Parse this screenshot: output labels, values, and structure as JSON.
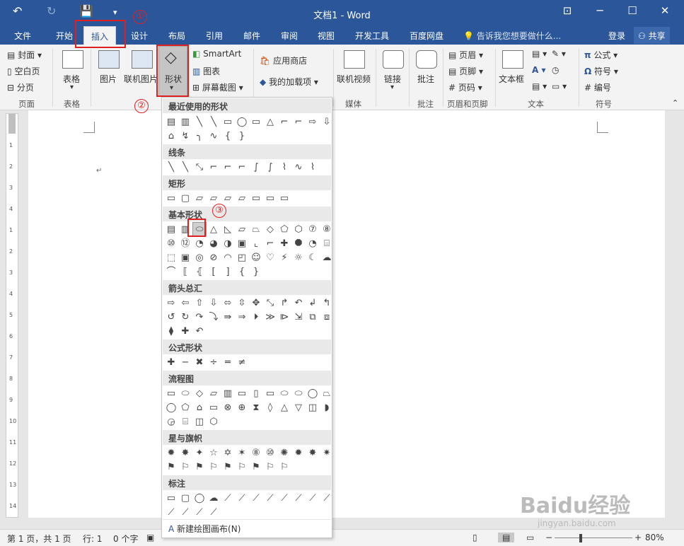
{
  "window": {
    "title": "文档1 - Word"
  },
  "titlebar_icons": [
    "undo-icon",
    "redo-icon",
    "save-icon",
    "customize-qat-icon"
  ],
  "tabs": [
    "文件",
    "开始",
    "插入",
    "设计",
    "布局",
    "引用",
    "邮件",
    "审阅",
    "视图",
    "开发工具",
    "百度网盘"
  ],
  "active_tab": "插入",
  "tell_me": "告诉我您想要做什么...",
  "login": "登录",
  "share": "共享",
  "ribbon": {
    "pages": {
      "cover": "封面",
      "blank": "空白页",
      "break": "分页",
      "group": "页面"
    },
    "tables": {
      "table": "表格",
      "group": "表格"
    },
    "illustrations": {
      "picture": "图片",
      "online_picture": "联机图片",
      "shapes": "形状",
      "smartart": "SmartArt",
      "chart": "图表",
      "screenshot": "屏幕截图"
    },
    "addins": {
      "store": "应用商店",
      "my_addins": "我的加载项"
    },
    "media": {
      "online_video": "联机视频",
      "group": "媒体"
    },
    "links": {
      "link": "链接"
    },
    "comments": {
      "comment": "批注",
      "group": "批注"
    },
    "header_footer": {
      "header": "页眉",
      "footer": "页脚",
      "page_number": "页码",
      "group": "页眉和页脚"
    },
    "text": {
      "textbox": "文本框",
      "group": "文本"
    },
    "symbols": {
      "equation": "公式",
      "symbol": "符号",
      "number": "编号",
      "group": "符号"
    }
  },
  "annotations": {
    "n1": "①",
    "n2": "②",
    "n3": "③"
  },
  "shapes_menu": {
    "sections": [
      "最近使用的形状",
      "线条",
      "矩形",
      "基本形状",
      "箭头总汇",
      "公式形状",
      "流程图",
      "星与旗帜",
      "标注"
    ],
    "new_canvas": "新建绘图画布(N)",
    "rows": {
      "recent1": [
        "▤",
        "▥",
        "╲",
        "╲",
        "▭",
        "◯",
        "▭",
        "△",
        "⌐",
        "⌐",
        "⇨",
        "⇩"
      ],
      "recent2": [
        "⌂",
        "↯",
        "╮",
        "∿",
        "{",
        "}"
      ],
      "lines": [
        "╲",
        "╲",
        "⤡",
        "⌐",
        "⌐",
        "⌐",
        "∫",
        "∫",
        "⌇",
        "∿",
        "⌇"
      ],
      "rects": [
        "▭",
        "▢",
        "▱",
        "▱",
        "▱",
        "▱",
        "▭",
        "▭",
        "▭"
      ],
      "basic1": [
        "▤",
        "▥",
        "⬭",
        "△",
        "◺",
        "▱",
        "⏢",
        "◇",
        "⬠",
        "⬡",
        "⑦",
        "⑧"
      ],
      "basic2": [
        "⑩",
        "⑫",
        "◔",
        "◕",
        "◑",
        "▣",
        "⌞",
        "⌐",
        "✚",
        "⯃",
        "◔",
        "⌸"
      ],
      "basic3": [
        "⬚",
        "▣",
        "◎",
        "⊘",
        "◠",
        "◰",
        "☺",
        "♡",
        "⚡",
        "☼",
        "☾",
        "☁"
      ],
      "basic4": [
        "⌒",
        "⟦",
        "⦃",
        "[",
        "]",
        "{",
        "}"
      ],
      "arrows1": [
        "⇨",
        "⇦",
        "⇧",
        "⇩",
        "⬄",
        "⇳",
        "✥",
        "⤡",
        "↱",
        "↶",
        "↲",
        "↰"
      ],
      "arrows2": [
        "↺",
        "↻",
        "↷",
        "⤵",
        "⇛",
        "⇒",
        "⏵",
        "≫",
        "⧐",
        "⇲",
        "⧉",
        "⧈"
      ],
      "arrows3": [
        "⧫",
        "✚",
        "↶"
      ],
      "equation": [
        "✚",
        "−",
        "✖",
        "÷",
        "═",
        "≠"
      ],
      "flow1": [
        "▭",
        "⬭",
        "◇",
        "▱",
        "▥",
        "▭",
        "▯",
        "▭",
        "⬭",
        "⬭",
        "◯",
        "⏢"
      ],
      "flow2": [
        "◯",
        "⬠",
        "⌂",
        "▭",
        "⊗",
        "⊕",
        "⧗",
        "◊",
        "△",
        "▽",
        "◫",
        "◗"
      ],
      "flow3": [
        "◶",
        "⌸",
        "◫",
        "⬡"
      ],
      "stars1": [
        "✹",
        "✸",
        "✦",
        "☆",
        "✡",
        "✶",
        "⑧",
        "⑩",
        "✺",
        "✹",
        "✸",
        "✷"
      ],
      "stars2": [
        "⚑",
        "⚐",
        "⚑",
        "⚐",
        "⚑",
        "⚐",
        "⚑",
        "⚐",
        "⚐"
      ],
      "callout1": [
        "▭",
        "▢",
        "◯",
        "☁",
        "⟋",
        "⟋",
        "⟋",
        "⟋",
        "⟋",
        "⟋",
        "⟋",
        "⟋"
      ],
      "callout2": [
        "⟋",
        "⟋",
        "⟋",
        "⟋"
      ]
    }
  },
  "status": {
    "page": "第 1 页，共 1 页",
    "words": "行: 1",
    "chars": "0 个字",
    "zoom": "80%"
  },
  "watermark": {
    "logo": "Baidu经验",
    "url": "jingyan.baidu.com"
  }
}
